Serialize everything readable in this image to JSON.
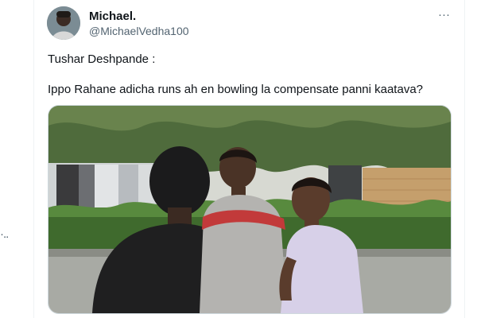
{
  "left_rail": {
    "overflow_label": "·.."
  },
  "tweet": {
    "author": {
      "display_name": "Michael.",
      "handle": "@MichaelVedha100"
    },
    "more_label": "···",
    "text": {
      "line1": "Tushar Deshpande :",
      "line2": "Ippo Rahane adicha runs ah en bowling la compensate panni kaatava?"
    },
    "media": {
      "type": "photo"
    }
  }
}
